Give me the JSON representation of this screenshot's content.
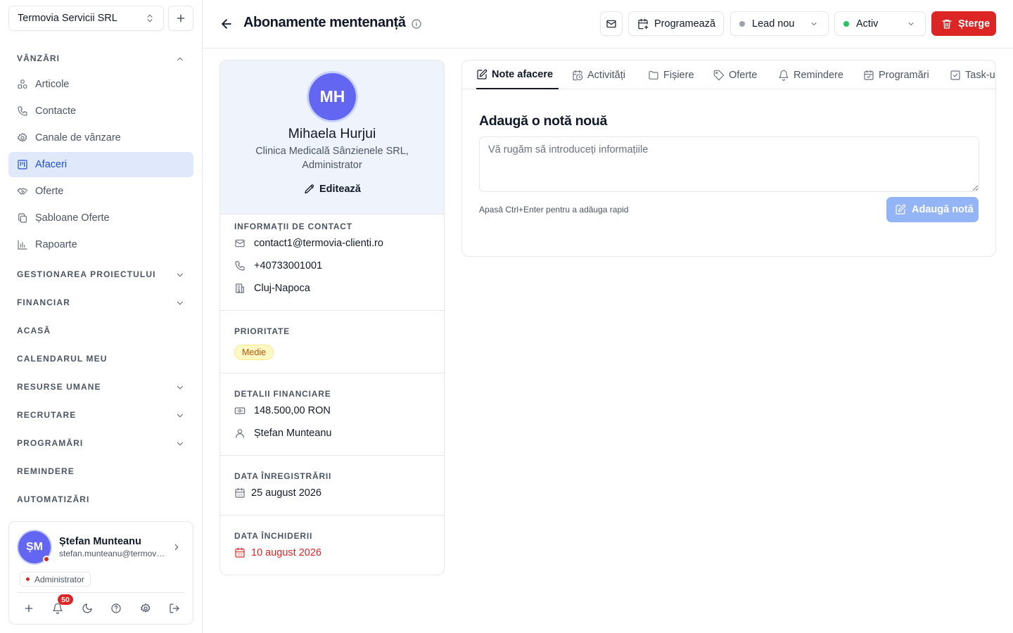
{
  "sidebar": {
    "company": "Termovia Servicii SRL",
    "sales_section": "VÂNZĂRI",
    "nav_items": [
      {
        "label": "Articole",
        "icon": "shapes-icon"
      },
      {
        "label": "Contacte",
        "icon": "phone-icon"
      },
      {
        "label": "Canale de vânzare",
        "icon": "gear-icon"
      },
      {
        "label": "Afaceri",
        "icon": "kanban-icon",
        "active": true
      },
      {
        "label": "Oferte",
        "icon": "handshake-icon"
      },
      {
        "label": "Șabloane Oferte",
        "icon": "copy-icon"
      },
      {
        "label": "Rapoarte",
        "icon": "bar-chart-icon"
      }
    ],
    "sections": [
      {
        "label": "GESTIONAREA PROIECTULUI",
        "expandable": true
      },
      {
        "label": "FINANCIAR",
        "expandable": true
      },
      {
        "label": "ACASĂ",
        "expandable": false
      },
      {
        "label": "CALENDARUL MEU",
        "expandable": false
      },
      {
        "label": "RESURSE UMANE",
        "expandable": true
      },
      {
        "label": "RECRUTARE",
        "expandable": true
      },
      {
        "label": "PROGRAMĂRI",
        "expandable": true
      },
      {
        "label": "REMINDERE",
        "expandable": false
      },
      {
        "label": "AUTOMATIZĂRI",
        "expandable": false
      }
    ],
    "user": {
      "initials": "ȘM",
      "name": "Ștefan Munteanu",
      "email": "stefan.munteanu@termovia-clienti.ro",
      "role": "Administrator",
      "notifications": "50"
    }
  },
  "header": {
    "title": "Abonamente mentenanță",
    "schedule_label": "Programează",
    "stage": "Lead nou",
    "stage_color": "#9ca3af",
    "status": "Activ",
    "status_color": "#22c55e",
    "delete_label": "Șterge"
  },
  "contact": {
    "initials": "MH",
    "name": "Mihaela Hurjui",
    "company_line": "Clinica Medicală Sânzienele SRL, Administrator",
    "edit_label": "Editează",
    "contact_info_label": "INFORMAȚII DE CONTACT",
    "email": "contact1@termovia-clienti.ro",
    "phone": "+40733001001",
    "city": "Cluj-Napoca",
    "priority_label": "PRIORITATE",
    "priority": "Medie",
    "financial_label": "DETALII FINANCIARE",
    "value": "148.500,00 RON",
    "owner": "Ștefan Munteanu",
    "registered_label": "DATA ÎNREGISTRĂRII",
    "registered_date": "25 august 2026",
    "closing_label": "DATA ÎNCHIDERII",
    "closing_date": "10 august 2026",
    "closing_date_color": "#dc2626"
  },
  "notes": {
    "tabs": [
      {
        "label": "Note afacere",
        "icon": "note-edit-icon",
        "active": true
      },
      {
        "label": "Activități",
        "icon": "calendar-clock-icon"
      },
      {
        "label": "Fișiere",
        "icon": "folder-icon"
      },
      {
        "label": "Oferte",
        "icon": "tag-icon"
      },
      {
        "label": "Remindere",
        "icon": "bell-icon"
      },
      {
        "label": "Programări",
        "icon": "calendar-check-icon"
      },
      {
        "label": "Task-uri",
        "icon": "checkbox-icon"
      }
    ],
    "heading": "Adaugă o notă nouă",
    "placeholder": "Vă rugăm să introduceți informațiile",
    "value": "",
    "hint": "Apasă Ctrl+Enter pentru a adăuga rapid",
    "add_label": "Adaugă notă"
  }
}
